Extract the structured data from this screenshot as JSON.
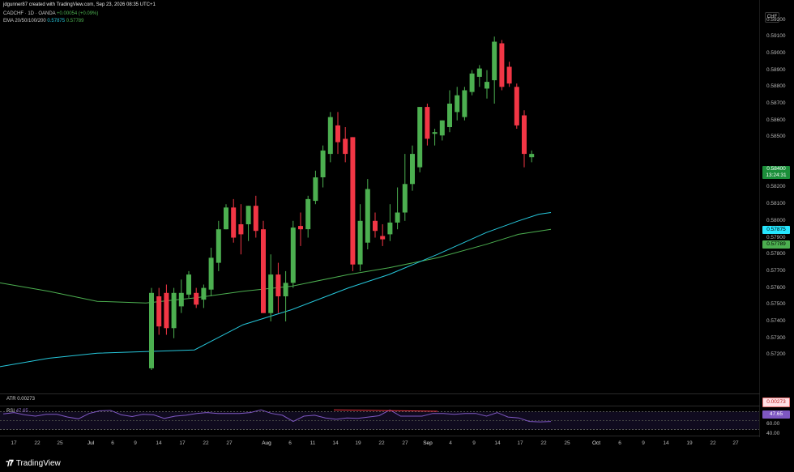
{
  "header": {
    "attribution": "jdgunner87 created with TradingView.com, Sep 23, 2026 08:35 UTC+1",
    "symbol_line": "CADCHF · 1D · OANDA",
    "change": "+0.00054 (+0.09%)",
    "ema_label": "EMA 20/50/100/200",
    "ema_value_1": "0.57875",
    "ema_value_2": "0.57789"
  },
  "currency_label": "CHF",
  "price_ticks": [
    "0.59200",
    "0.59100",
    "0.59000",
    "0.58900",
    "0.58800",
    "0.58700",
    "0.58600",
    "0.58500",
    "0.58300",
    "0.58200",
    "0.58100",
    "0.58000",
    "0.57900",
    "0.57800",
    "0.57700",
    "0.57600",
    "0.57500",
    "0.57400",
    "0.57300",
    "0.57200"
  ],
  "tags": {
    "last_price": "0.58400",
    "countdown": "13:24:31",
    "ema_fast": "0.57875",
    "ema_slow": "0.57789",
    "atr": "0.00273",
    "rsi": "47.65"
  },
  "indicators": {
    "atr_label": "ATR",
    "atr_value": "0.00273",
    "rsi_label": "RSI",
    "rsi_value": "47.65",
    "rsi_ticks": [
      "60.00",
      "40.00"
    ]
  },
  "date_labels": [
    {
      "text": "17",
      "x": 17,
      "month": false
    },
    {
      "text": "22",
      "x": 46,
      "month": false
    },
    {
      "text": "25",
      "x": 74,
      "month": false
    },
    {
      "text": "Jul",
      "x": 112,
      "month": true
    },
    {
      "text": "6",
      "x": 139,
      "month": false
    },
    {
      "text": "9",
      "x": 167,
      "month": false
    },
    {
      "text": "14",
      "x": 196,
      "month": false
    },
    {
      "text": "17",
      "x": 225,
      "month": false
    },
    {
      "text": "22",
      "x": 254,
      "month": false
    },
    {
      "text": "27",
      "x": 283,
      "month": false
    },
    {
      "text": "Aug",
      "x": 329,
      "month": true
    },
    {
      "text": "6",
      "x": 358,
      "month": false
    },
    {
      "text": "11",
      "x": 386,
      "month": false
    },
    {
      "text": "14",
      "x": 414,
      "month": false
    },
    {
      "text": "19",
      "x": 442,
      "month": false
    },
    {
      "text": "22",
      "x": 471,
      "month": false
    },
    {
      "text": "27",
      "x": 500,
      "month": false
    },
    {
      "text": "Sep",
      "x": 528,
      "month": true
    },
    {
      "text": "4",
      "x": 556,
      "month": false
    },
    {
      "text": "9",
      "x": 585,
      "month": false
    },
    {
      "text": "14",
      "x": 614,
      "month": false
    },
    {
      "text": "17",
      "x": 642,
      "month": false
    },
    {
      "text": "22",
      "x": 671,
      "month": false
    },
    {
      "text": "25",
      "x": 700,
      "month": false
    },
    {
      "text": "Oct",
      "x": 736,
      "month": true
    },
    {
      "text": "6",
      "x": 765,
      "month": false
    },
    {
      "text": "9",
      "x": 794,
      "month": false
    },
    {
      "text": "14",
      "x": 822,
      "month": false
    },
    {
      "text": "19",
      "x": 851,
      "month": false
    },
    {
      "text": "22",
      "x": 880,
      "month": false
    },
    {
      "text": "27",
      "x": 908,
      "month": false
    }
  ],
  "footer": {
    "brand": "TradingView"
  },
  "colors": {
    "up": "#4caf50",
    "down": "#f23645",
    "ema_fast": "#26c6da",
    "ema_slow": "#4caf50",
    "rsi": "#7e57c2"
  },
  "chart_data": {
    "type": "candlestick",
    "symbol": "CADCHF",
    "timeframe": "1D",
    "ylim": [
      0.5711,
      0.5928
    ],
    "candles": [
      {
        "o": 0.5712,
        "h": 0.576,
        "l": 0.5711,
        "c": 0.5757
      },
      {
        "o": 0.5755,
        "h": 0.576,
        "l": 0.5732,
        "c": 0.5737
      },
      {
        "o": 0.5757,
        "h": 0.5762,
        "l": 0.5732,
        "c": 0.5736
      },
      {
        "o": 0.5736,
        "h": 0.576,
        "l": 0.573,
        "c": 0.5757
      },
      {
        "o": 0.5749,
        "h": 0.5765,
        "l": 0.5745,
        "c": 0.5757
      },
      {
        "o": 0.5756,
        "h": 0.577,
        "l": 0.5754,
        "c": 0.5768
      },
      {
        "o": 0.5757,
        "h": 0.576,
        "l": 0.5748,
        "c": 0.575
      },
      {
        "o": 0.5753,
        "h": 0.5762,
        "l": 0.5748,
        "c": 0.576
      },
      {
        "o": 0.5759,
        "h": 0.5784,
        "l": 0.5755,
        "c": 0.5778
      },
      {
        "o": 0.5775,
        "h": 0.58,
        "l": 0.577,
        "c": 0.5795
      },
      {
        "o": 0.5795,
        "h": 0.581,
        "l": 0.5795,
        "c": 0.5808
      },
      {
        "o": 0.5808,
        "h": 0.5813,
        "l": 0.5787,
        "c": 0.579
      },
      {
        "o": 0.5798,
        "h": 0.581,
        "l": 0.578,
        "c": 0.5792
      },
      {
        "o": 0.5798,
        "h": 0.5809,
        "l": 0.5788,
        "c": 0.5809
      },
      {
        "o": 0.5809,
        "h": 0.5815,
        "l": 0.579,
        "c": 0.5794
      },
      {
        "o": 0.5795,
        "h": 0.58,
        "l": 0.5745,
        "c": 0.5745
      },
      {
        "o": 0.5745,
        "h": 0.578,
        "l": 0.574,
        "c": 0.5768
      },
      {
        "o": 0.5768,
        "h": 0.5775,
        "l": 0.5745,
        "c": 0.5755
      },
      {
        "o": 0.5755,
        "h": 0.577,
        "l": 0.574,
        "c": 0.5763
      },
      {
        "o": 0.5763,
        "h": 0.58,
        "l": 0.576,
        "c": 0.5796
      },
      {
        "o": 0.5797,
        "h": 0.5805,
        "l": 0.5785,
        "c": 0.5795
      },
      {
        "o": 0.5795,
        "h": 0.5815,
        "l": 0.579,
        "c": 0.5813
      },
      {
        "o": 0.5812,
        "h": 0.583,
        "l": 0.581,
        "c": 0.5826
      },
      {
        "o": 0.5826,
        "h": 0.5845,
        "l": 0.582,
        "c": 0.5842
      },
      {
        "o": 0.584,
        "h": 0.5865,
        "l": 0.5835,
        "c": 0.5862
      },
      {
        "o": 0.5857,
        "h": 0.5865,
        "l": 0.584,
        "c": 0.5847
      },
      {
        "o": 0.5849,
        "h": 0.5856,
        "l": 0.5835,
        "c": 0.584
      },
      {
        "o": 0.585,
        "h": 0.585,
        "l": 0.577,
        "c": 0.5774
      },
      {
        "o": 0.5774,
        "h": 0.581,
        "l": 0.577,
        "c": 0.58
      },
      {
        "o": 0.5787,
        "h": 0.5825,
        "l": 0.5783,
        "c": 0.5819
      },
      {
        "o": 0.58,
        "h": 0.5805,
        "l": 0.579,
        "c": 0.5794
      },
      {
        "o": 0.5791,
        "h": 0.5798,
        "l": 0.5785,
        "c": 0.5789
      },
      {
        "o": 0.5792,
        "h": 0.581,
        "l": 0.5788,
        "c": 0.5799
      },
      {
        "o": 0.5799,
        "h": 0.582,
        "l": 0.5795,
        "c": 0.5805
      },
      {
        "o": 0.5805,
        "h": 0.584,
        "l": 0.58,
        "c": 0.5822
      },
      {
        "o": 0.5822,
        "h": 0.5845,
        "l": 0.5818,
        "c": 0.584
      },
      {
        "o": 0.5832,
        "h": 0.5868,
        "l": 0.5829,
        "c": 0.5868
      },
      {
        "o": 0.5868,
        "h": 0.587,
        "l": 0.5845,
        "c": 0.5849
      },
      {
        "o": 0.5852,
        "h": 0.5855,
        "l": 0.5845,
        "c": 0.5853
      },
      {
        "o": 0.5851,
        "h": 0.586,
        "l": 0.5848,
        "c": 0.586
      },
      {
        "o": 0.5856,
        "h": 0.5878,
        "l": 0.5853,
        "c": 0.587
      },
      {
        "o": 0.5865,
        "h": 0.588,
        "l": 0.586,
        "c": 0.5875
      },
      {
        "o": 0.5862,
        "h": 0.588,
        "l": 0.586,
        "c": 0.5878
      },
      {
        "o": 0.5877,
        "h": 0.589,
        "l": 0.5875,
        "c": 0.5888
      },
      {
        "o": 0.5886,
        "h": 0.5893,
        "l": 0.588,
        "c": 0.5891
      },
      {
        "o": 0.5879,
        "h": 0.589,
        "l": 0.5873,
        "c": 0.5883
      },
      {
        "o": 0.5884,
        "h": 0.591,
        "l": 0.587,
        "c": 0.5907
      },
      {
        "o": 0.5906,
        "h": 0.5908,
        "l": 0.5878,
        "c": 0.588
      },
      {
        "o": 0.5892,
        "h": 0.5895,
        "l": 0.588,
        "c": 0.5882
      },
      {
        "o": 0.588,
        "h": 0.5882,
        "l": 0.5855,
        "c": 0.5857
      },
      {
        "o": 0.5863,
        "h": 0.5866,
        "l": 0.5832,
        "c": 0.584
      },
      {
        "o": 0.5838,
        "h": 0.5842,
        "l": 0.5835,
        "c": 0.584
      }
    ],
    "ema_fast": [
      [
        0,
        0.5713
      ],
      [
        60,
        0.5718
      ],
      [
        120,
        0.5721
      ],
      [
        180,
        0.5722
      ],
      [
        240,
        0.5723
      ],
      [
        300,
        0.5738
      ],
      [
        360,
        0.5747
      ],
      [
        430,
        0.576
      ],
      [
        480,
        0.5768
      ],
      [
        540,
        0.578
      ],
      [
        600,
        0.5793
      ],
      [
        640,
        0.58
      ],
      [
        665,
        0.5804
      ],
      [
        680,
        0.5805
      ]
    ],
    "ema_slow": [
      [
        0,
        0.5763
      ],
      [
        60,
        0.5758
      ],
      [
        120,
        0.5752
      ],
      [
        180,
        0.5751
      ],
      [
        240,
        0.5754
      ],
      [
        300,
        0.5758
      ],
      [
        360,
        0.5761
      ],
      [
        430,
        0.5768
      ],
      [
        480,
        0.5772
      ],
      [
        540,
        0.5778
      ],
      [
        600,
        0.5786
      ],
      [
        640,
        0.5792
      ],
      [
        680,
        0.5795
      ]
    ],
    "rsi": [
      65,
      68,
      63,
      60,
      64,
      64,
      58,
      54,
      66,
      72,
      73,
      63,
      59,
      64,
      63,
      55,
      60,
      62,
      66,
      68,
      66,
      66,
      66,
      68,
      74,
      66,
      62,
      48,
      60,
      62,
      56,
      53,
      56,
      55,
      58,
      61,
      74,
      60,
      60,
      60,
      66,
      66,
      64,
      66,
      66,
      60,
      68,
      58,
      56,
      48,
      47,
      48
    ],
    "rsi_ylim": [
      20,
      80
    ]
  }
}
